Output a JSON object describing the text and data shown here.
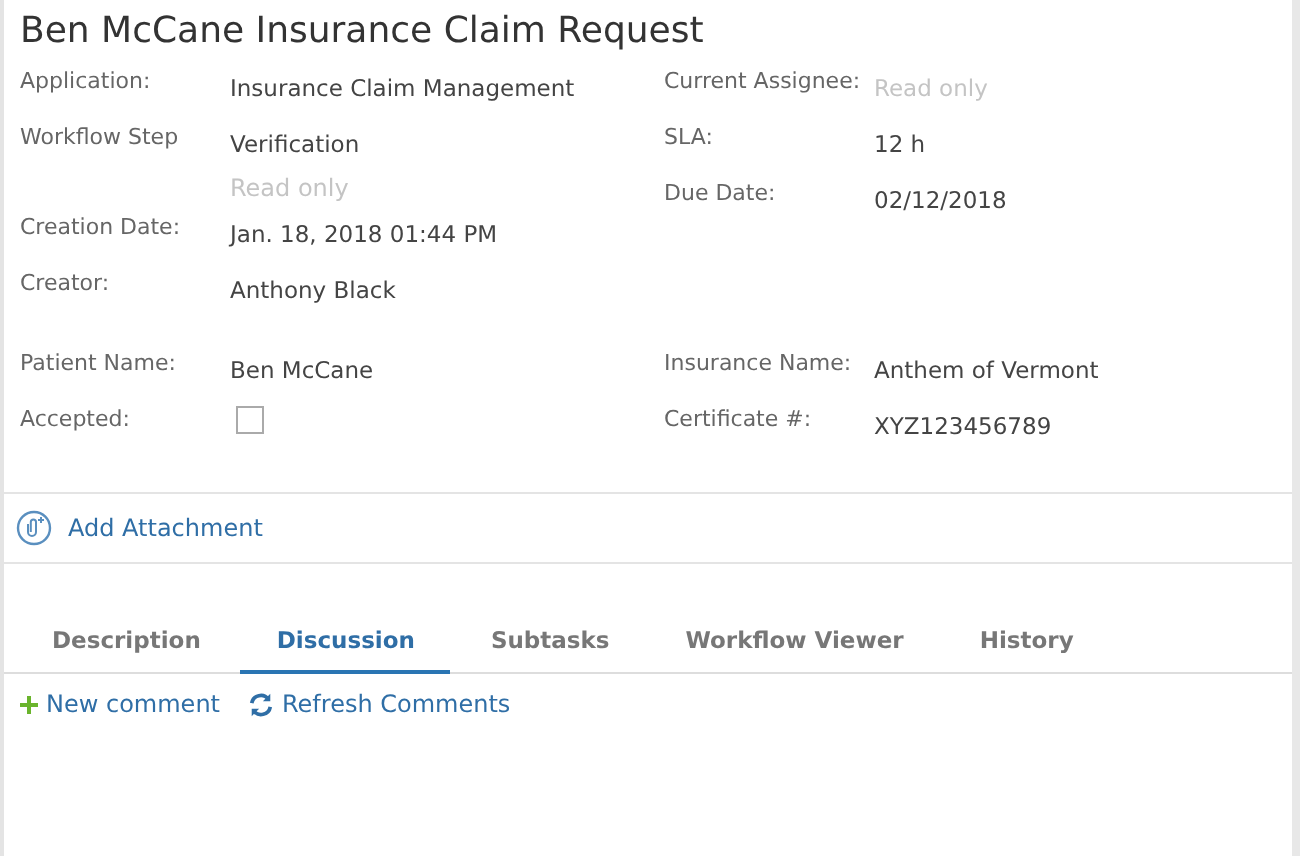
{
  "title": "Ben McCane Insurance Claim Request",
  "sections": [
    {
      "left": [
        {
          "label": "Application:",
          "kind": "text",
          "value": "Insurance Claim Management"
        },
        {
          "label": "Workflow Step",
          "kind": "text",
          "value": "Verification",
          "note": "Read only"
        },
        {
          "label": "Creation Date:",
          "kind": "text",
          "value": "Jan. 18, 2018 01:44 PM"
        },
        {
          "label": "Creator:",
          "kind": "text",
          "value": "Anthony Black"
        }
      ],
      "right": [
        {
          "label": "Current Assignee:",
          "kind": "empty",
          "placeholder": "Read only"
        },
        {
          "label": "SLA:",
          "kind": "text",
          "value": "12 h"
        },
        {
          "label": "Due Date:",
          "kind": "text",
          "value": "02/12/2018"
        }
      ]
    },
    {
      "left": [
        {
          "label": "Patient Name:",
          "kind": "text",
          "value": "Ben McCane"
        },
        {
          "label": "Accepted:",
          "kind": "checkbox",
          "checked": false
        }
      ],
      "right": [
        {
          "label": "Insurance Name:",
          "kind": "text",
          "value": "Anthem of Vermont"
        },
        {
          "label": "Certificate #:",
          "kind": "text",
          "value": "XYZ123456789"
        }
      ]
    }
  ],
  "attachment": "Add Attachment",
  "tabs": [
    {
      "label": "Description",
      "selected": false
    },
    {
      "label": "Discussion",
      "selected": true
    },
    {
      "label": "Subtasks",
      "selected": false
    },
    {
      "label": "Workflow Viewer",
      "selected": false
    },
    {
      "label": "History",
      "selected": false
    }
  ],
  "actions": [
    {
      "kind": "new",
      "label": "New comment"
    },
    {
      "kind": "refresh",
      "label": "Refresh Comments"
    }
  ]
}
